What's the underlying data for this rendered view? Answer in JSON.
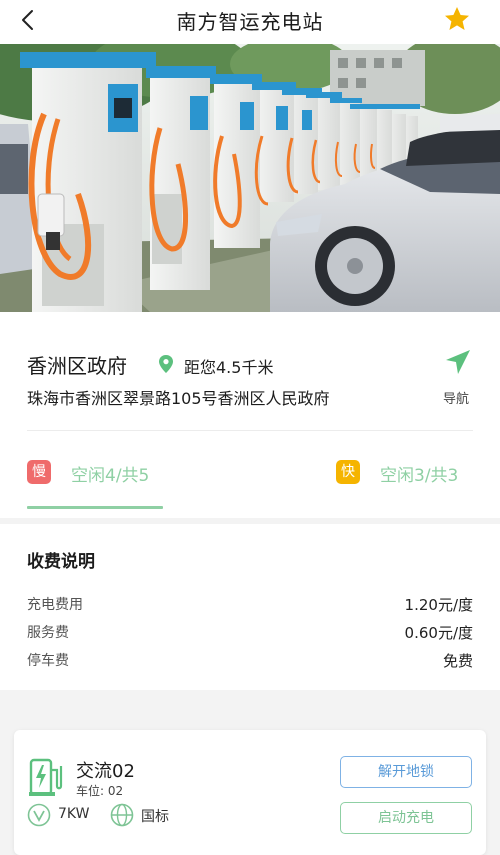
{
  "header": {
    "title": "南方智运充电站",
    "back_icon": "chevron-left-icon",
    "favorite_icon": "star-icon",
    "favorite_color": "#f5b400"
  },
  "station": {
    "name": "香洲区政府",
    "distance": "距您4.5千米",
    "address": "珠海市香洲区翠景路105号香洲区人民政府",
    "navigate_label": "导航",
    "accent": "#8fd0a4"
  },
  "availability": {
    "slow": {
      "tag": "慢",
      "status": "空闲4/共5",
      "color": "#ef6b6b"
    },
    "fast": {
      "tag": "快",
      "status": "空闲3/共3",
      "color": "#f5b400"
    }
  },
  "fees": {
    "title": "收费说明",
    "rows": [
      {
        "label": "充电费用",
        "value": "1.20元/度"
      },
      {
        "label": "服务费",
        "value": "0.60元/度"
      },
      {
        "label": "停车费",
        "value": "免费"
      }
    ]
  },
  "charger": {
    "name": "交流02",
    "slot": "车位: 02",
    "power": "7KW",
    "standard": "国标",
    "unlock_label": "解开地锁",
    "start_label": "启动充电"
  }
}
